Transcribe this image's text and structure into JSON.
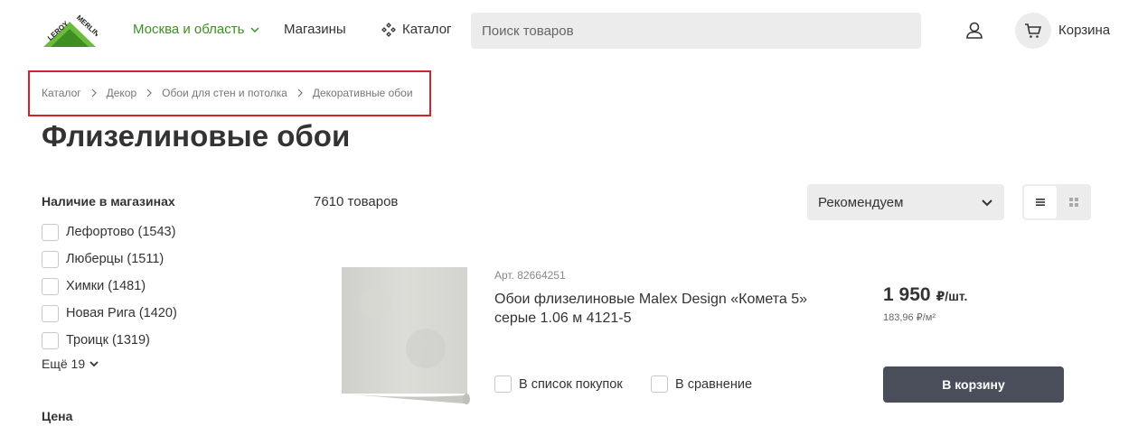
{
  "header": {
    "logo_text": "LEROY MERLIN",
    "region_label": "Москва и область",
    "stores_label": "Магазины",
    "catalog_label": "Каталог",
    "search_placeholder": "Поиск товаров",
    "cart_label": "Корзина"
  },
  "breadcrumb": {
    "items": [
      "Каталог",
      "Декор",
      "Обои для стен и потолка",
      "Декоративные обои"
    ]
  },
  "page_title": "Флизелиновые обои",
  "filters": {
    "availability_title": "Наличие в магазинах",
    "stores": [
      {
        "label": "Лефортово (1543)",
        "checked": false
      },
      {
        "label": "Люберцы (1511)",
        "checked": false
      },
      {
        "label": "Химки (1481)",
        "checked": false
      },
      {
        "label": "Новая Рига (1420)",
        "checked": false
      },
      {
        "label": "Троицк (1319)",
        "checked": false
      }
    ],
    "more_label": "Ещё 19",
    "price_title": "Цена"
  },
  "listing": {
    "count_label": "7610 товаров",
    "sort_selected": "Рекомендуем",
    "view_mode": "list"
  },
  "product": {
    "sku": "Арт. 82664251",
    "name": "Обои флизелиновые Malex Design «Комета 5» серые 1.06 м 4121-5",
    "shopping_list_label": "В список покупок",
    "compare_label": "В сравнение",
    "price": "1 950",
    "price_unit": "₽/шт.",
    "price_per_m2": "183,96 ₽/м²",
    "buy_label": "В корзину"
  },
  "colors": {
    "brand_green": "#3d8f23",
    "highlight_red": "#d1232a",
    "button_dark": "#4a4e5a"
  }
}
